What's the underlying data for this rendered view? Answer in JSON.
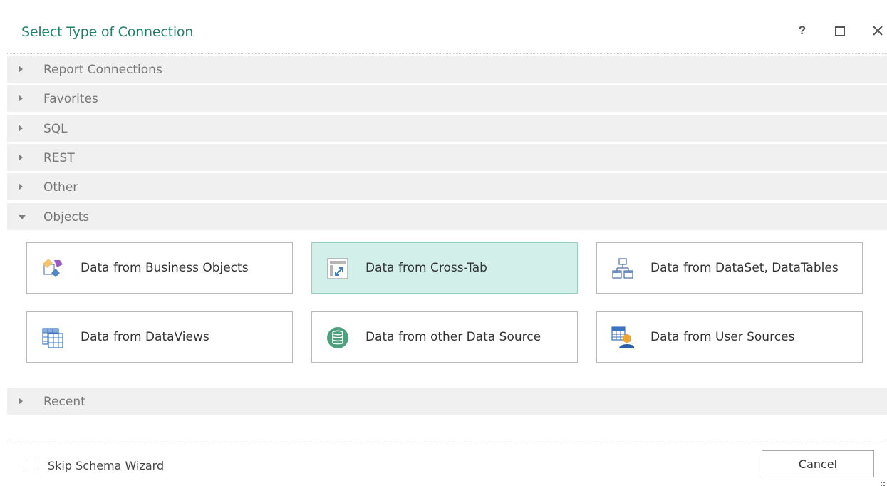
{
  "dialog": {
    "title": "Select Type of Connection",
    "help_label": "?"
  },
  "groups": [
    {
      "label": "Report Connections",
      "expanded": false
    },
    {
      "label": "Favorites",
      "expanded": false
    },
    {
      "label": "SQL",
      "expanded": false
    },
    {
      "label": "REST",
      "expanded": false
    },
    {
      "label": "Other",
      "expanded": false
    },
    {
      "label": "Objects",
      "expanded": true
    },
    {
      "label": "Recent",
      "expanded": false
    }
  ],
  "objects": [
    {
      "label": "Data from Business Objects",
      "icon": "business-objects-icon",
      "selected": false
    },
    {
      "label": "Data from Cross-Tab",
      "icon": "cross-tab-icon",
      "selected": true
    },
    {
      "label": "Data from DataSet, DataTables",
      "icon": "dataset-icon",
      "selected": false
    },
    {
      "label": "Data from DataViews",
      "icon": "dataviews-icon",
      "selected": false
    },
    {
      "label": "Data from other Data Source",
      "icon": "database-icon",
      "selected": false
    },
    {
      "label": "Data from User Sources",
      "icon": "user-sources-icon",
      "selected": false
    }
  ],
  "footer": {
    "skip_schema_label": "Skip Schema Wizard",
    "skip_schema_checked": false,
    "cancel_label": "Cancel"
  },
  "colors": {
    "title": "#21826a",
    "selected_bg": "#d3efe9",
    "group_bg": "#f0f0f0"
  }
}
